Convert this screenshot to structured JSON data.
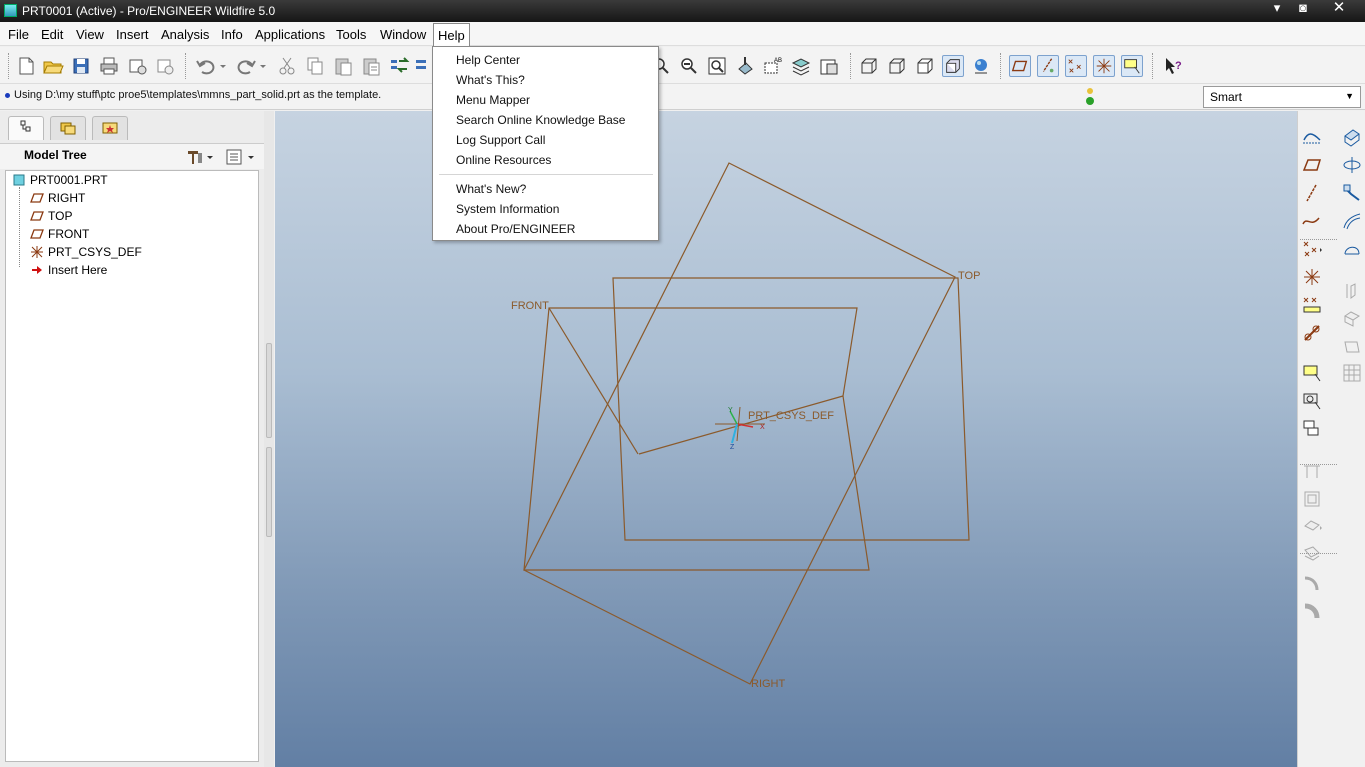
{
  "window": {
    "title": "PRT0001 (Active) - Pro/ENGINEER Wildfire 5.0",
    "controls": [
      "▾",
      "◙",
      "✕"
    ]
  },
  "menubar": {
    "items": [
      "File",
      "Edit",
      "View",
      "Insert",
      "Analysis",
      "Info",
      "Applications",
      "Tools",
      "Window",
      "Help"
    ],
    "active": "Help"
  },
  "help_menu": {
    "group1": [
      "Help Center",
      "What's This?",
      "Menu Mapper",
      "Search Online Knowledge Base",
      "Log Support Call",
      "Online Resources"
    ],
    "group2": [
      "What's New?",
      "System Information",
      "About Pro/ENGINEER"
    ]
  },
  "status": {
    "message": "Using D:\\my stuff\\ptc proe5\\templates\\mmns_part_solid.prt as the template.",
    "filter": "Smart",
    "filter_arrow": "▼"
  },
  "model_tree": {
    "title": "Model Tree",
    "root": "PRT0001.PRT",
    "items": [
      {
        "label": "RIGHT",
        "icon": "datum-plane-icon"
      },
      {
        "label": "TOP",
        "icon": "datum-plane-icon"
      },
      {
        "label": "FRONT",
        "icon": "datum-plane-icon"
      },
      {
        "label": "PRT_CSYS_DEF",
        "icon": "csys-icon"
      },
      {
        "label": "Insert Here",
        "icon": "insert-arrow-icon"
      }
    ]
  },
  "graphics": {
    "labels": {
      "front": "FRONT",
      "top": "TOP",
      "right": "RIGHT",
      "csys": "PRT_CSYS_DEF",
      "axis_x": "X",
      "axis_y": "Y",
      "axis_z": "Z"
    },
    "datum_color": "#8b5a2b"
  },
  "colors": {
    "accent": "#7da2ce",
    "datum": "#8b5a2b",
    "background_top": "#c6d3e1",
    "background_bottom": "#627fa4"
  }
}
